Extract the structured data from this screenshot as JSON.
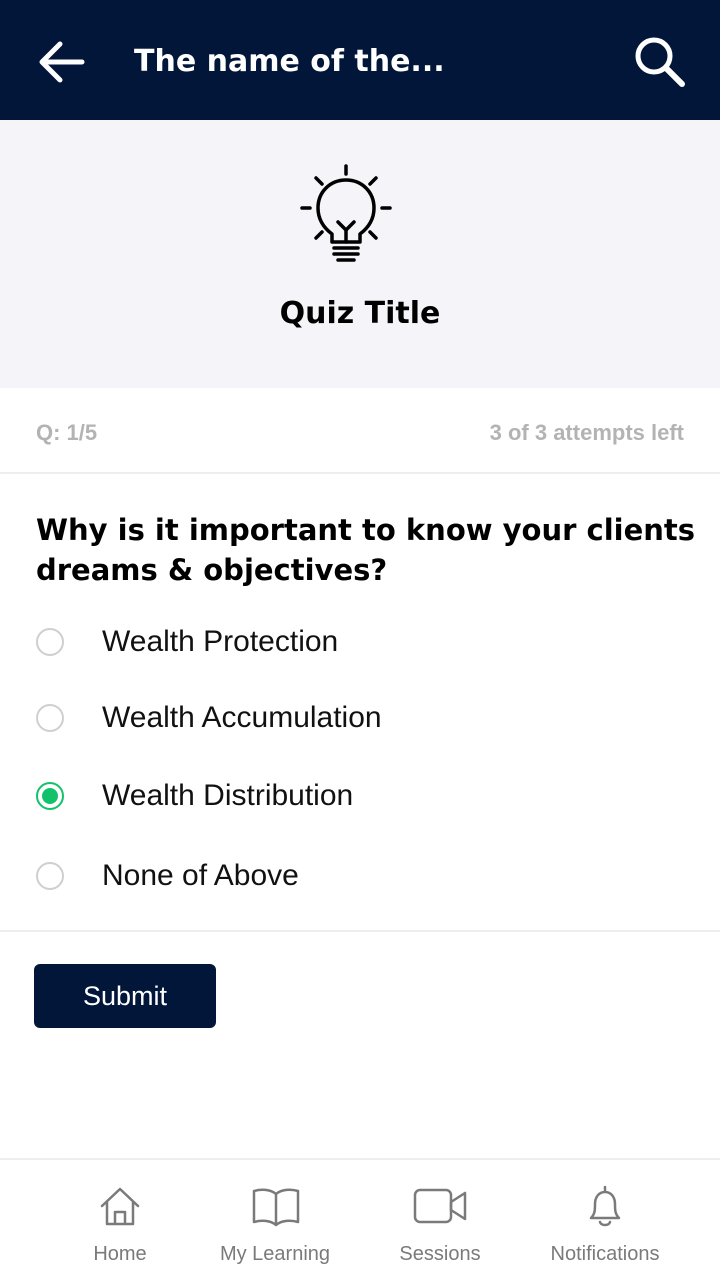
{
  "app_bar": {
    "title": "The name of the...",
    "back_icon": "arrow-left-icon",
    "search_icon": "search-icon"
  },
  "quiz": {
    "icon": "lightbulb-icon",
    "title": "Quiz Title"
  },
  "meta": {
    "counter": "Q: 1/5",
    "attempts": "3 of 3 attempts left"
  },
  "question": {
    "text": "Why is it important to know your clients dreams & objectives?",
    "options": [
      {
        "label": "Wealth Protection",
        "selected": false
      },
      {
        "label": "Wealth Accumulation",
        "selected": false
      },
      {
        "label": "Wealth Distribution",
        "selected": true
      },
      {
        "label": "None of Above",
        "selected": false
      }
    ]
  },
  "submit": {
    "label": "Submit"
  },
  "bottom_nav": {
    "items": [
      {
        "label": "Home",
        "icon": "home-icon"
      },
      {
        "label": "My Learning",
        "icon": "book-icon"
      },
      {
        "label": "Sessions",
        "icon": "video-camera-icon"
      },
      {
        "label": "Notifications",
        "icon": "bell-icon"
      }
    ]
  },
  "colors": {
    "primary": "#02163a",
    "accent_selected": "#12c26b",
    "header_bg": "#f4f4f9",
    "muted_text": "#b3b3b3",
    "nav_text": "#7a7a7a"
  }
}
